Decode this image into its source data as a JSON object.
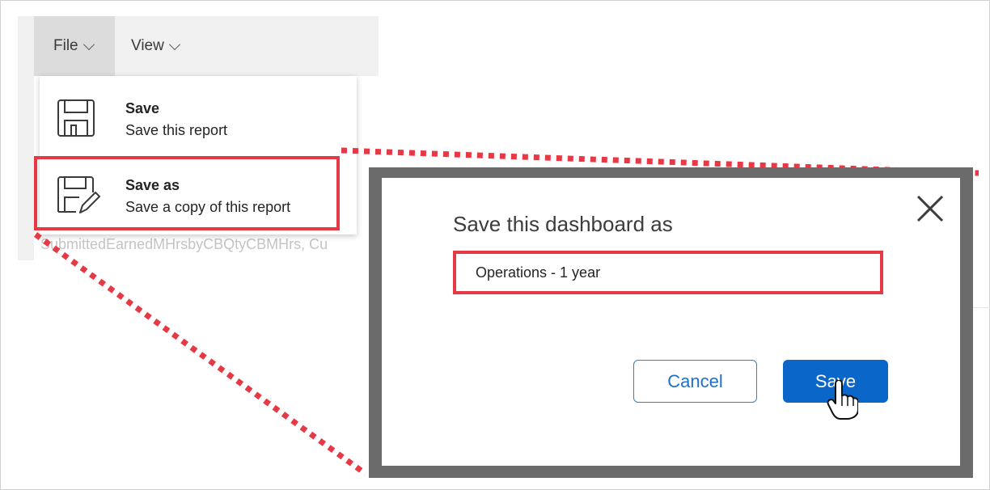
{
  "menubar": {
    "tabs": [
      {
        "label": "File"
      },
      {
        "label": "View"
      }
    ]
  },
  "file_menu": {
    "items": [
      {
        "title": "Save",
        "subtitle": "Save this report",
        "icon": "floppy-disk-icon"
      },
      {
        "title": "Save as",
        "subtitle": "Save a copy of this report",
        "icon": "floppy-disk-pencil-icon"
      }
    ]
  },
  "background": {
    "field_list_text": "SubmittedEarnedMHrsbyCBQtyCBMHrs, Cu"
  },
  "dialog": {
    "title": "Save this dashboard as",
    "name_value": "Operations - 1 year",
    "cancel_label": "Cancel",
    "save_label": "Save",
    "close_icon": "close-icon"
  },
  "colors": {
    "highlight": "#e63946",
    "primary_button": "#0b66c9",
    "dialog_frame": "#6b6b6b"
  }
}
